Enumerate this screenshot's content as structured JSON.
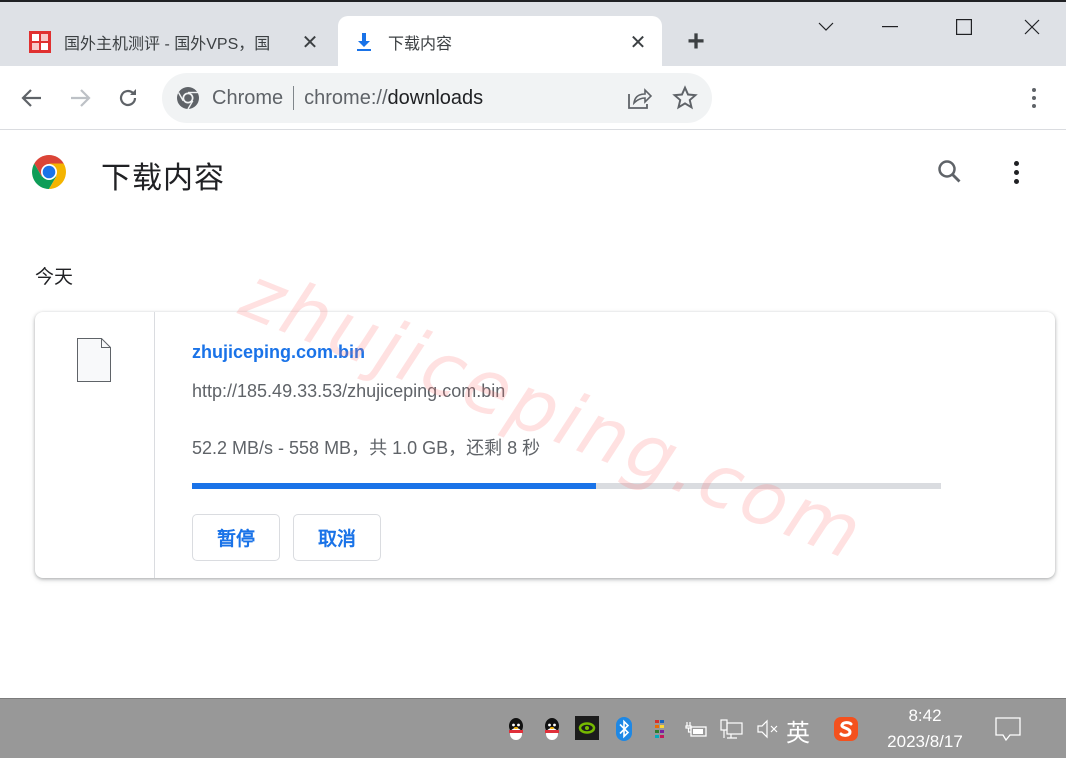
{
  "browser": {
    "tabs": [
      {
        "title": "国外主机测评 - 国外VPS，国",
        "active": false,
        "icon": "site-favicon"
      },
      {
        "title": "下载内容",
        "active": true,
        "icon": "download-icon"
      }
    ],
    "new_tab_label": "+",
    "address": {
      "scheme_label": "Chrome",
      "url_prefix": "chrome://",
      "url_host": "downloads"
    }
  },
  "page": {
    "title": "下载内容",
    "date_header": "今天",
    "accent_color": "#1a73e8"
  },
  "download": {
    "file_name": "zhujiceping.com.bin",
    "url": "http://185.49.33.53/zhujiceping.com.bin",
    "status": "52.2 MB/s - 558 MB，共 1.0 GB，还剩 8 秒",
    "progress_fraction": 0.54,
    "buttons": {
      "pause": "暂停",
      "cancel": "取消"
    }
  },
  "watermark": "zhujiceping.com",
  "taskbar": {
    "ime_label": "英",
    "time": "8:42",
    "date": "2023/8/17",
    "tray_icons": [
      "qq-icon",
      "qq-icon",
      "nvidia-icon",
      "bluetooth-icon",
      "color-grid-icon",
      "power-plug-battery-icon",
      "network-icon",
      "volume-muted-icon",
      "ime-icon",
      "sogou-icon",
      "notification-icon"
    ]
  }
}
